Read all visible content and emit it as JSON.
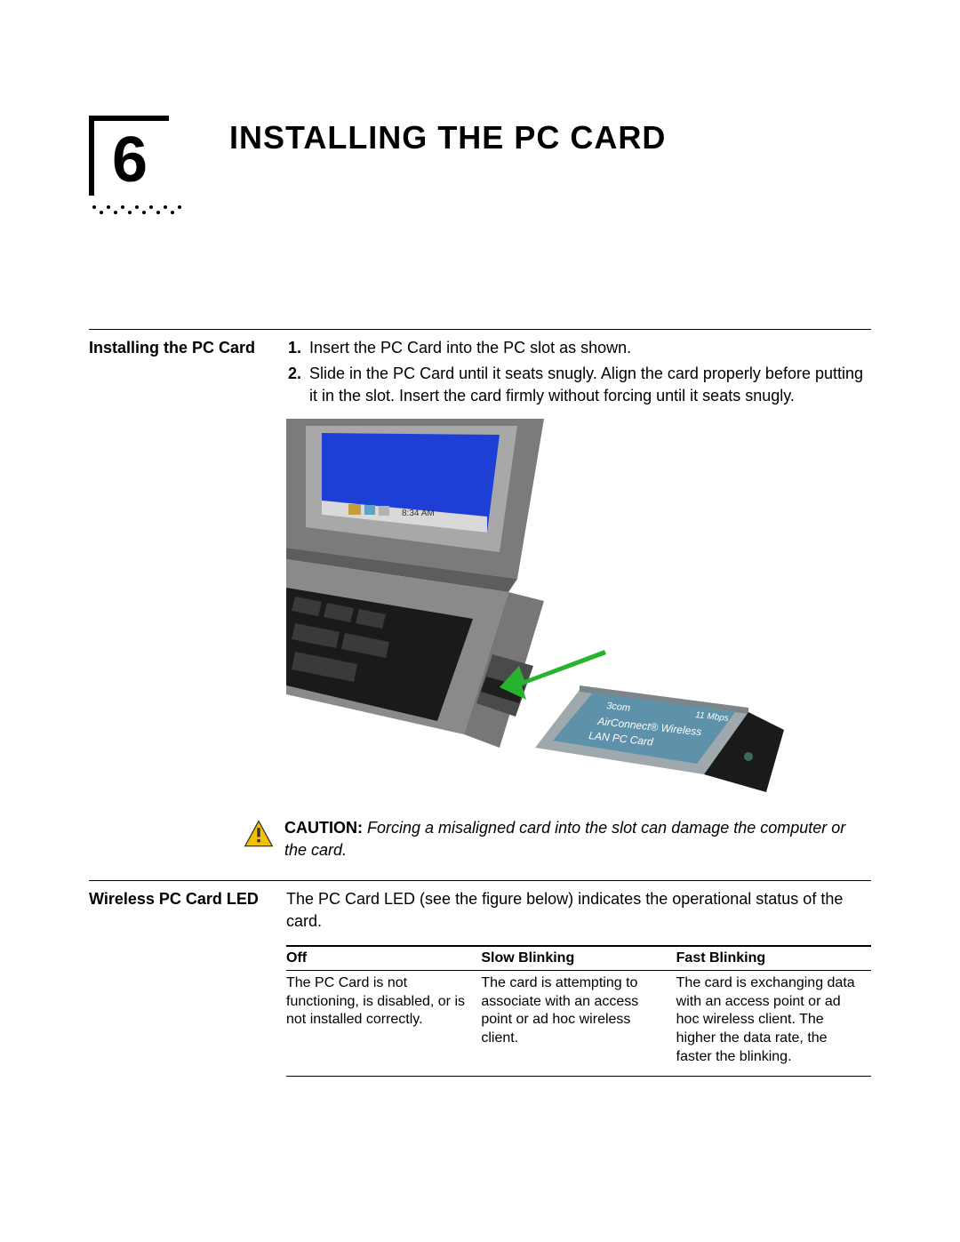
{
  "chapter": {
    "number": "6",
    "title": "INSTALLING THE PC CARD"
  },
  "section1": {
    "heading": "Installing the PC Card",
    "steps": [
      "Insert the PC Card into the PC slot as shown.",
      "Slide in the PC Card until it seats snugly. Align the card properly before putting it in the slot. Insert the card firmly without forcing until it seats snugly."
    ]
  },
  "figure": {
    "tray_time": "8:34 AM",
    "card_line1": "3com",
    "card_line2": "AirConnect® Wireless",
    "card_line3": "LAN PC Card",
    "card_rate": "11 Mbps"
  },
  "caution": {
    "label": "CAUTION:",
    "text": "Forcing a misaligned card into the slot can damage the computer or the card."
  },
  "section2": {
    "heading": "Wireless PC Card LED",
    "body": "The PC Card LED (see the figure below) indicates the operational status of the card.",
    "table": {
      "headers": [
        "Off",
        "Slow Blinking",
        "Fast Blinking"
      ],
      "cells": [
        "The PC Card is not functioning, is disabled, or is not installed correctly.",
        "The card is attempting to associate with an access point or ad hoc wireless client.",
        "The card is exchanging data with an access point or ad hoc wireless client. The higher the data rate, the faster the blinking."
      ]
    }
  }
}
